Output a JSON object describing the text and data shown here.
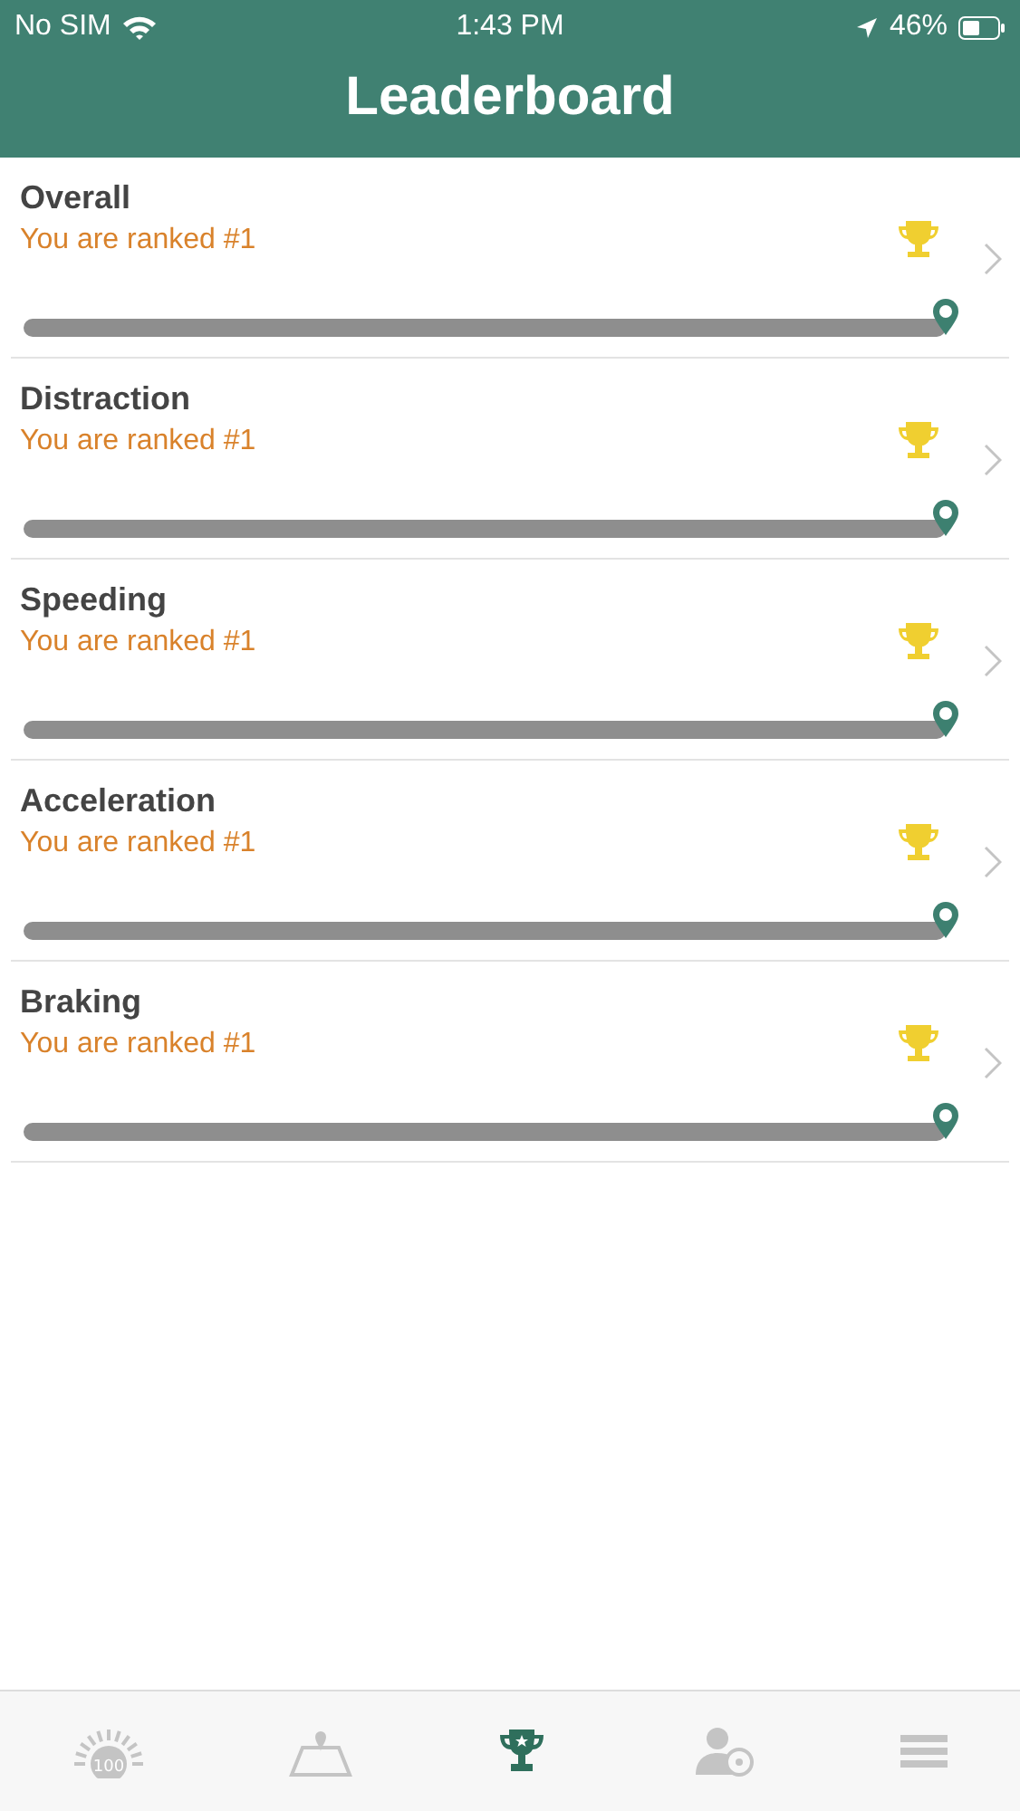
{
  "status_bar": {
    "carrier": "No SIM",
    "time": "1:43 PM",
    "battery": "46%"
  },
  "header": {
    "title": "Leaderboard"
  },
  "rows": [
    {
      "title": "Overall",
      "subtitle": "You are ranked #1",
      "level": 1
    },
    {
      "title": "Distraction",
      "subtitle": "You are ranked #1",
      "level": 1
    },
    {
      "title": "Speeding",
      "subtitle": "You are ranked #1",
      "level": 1
    },
    {
      "title": "Acceleration",
      "subtitle": "You are ranked #1",
      "level": 1
    },
    {
      "title": "Braking",
      "subtitle": "You are ranked #1",
      "level": 1
    }
  ],
  "tab_bar": [
    {
      "kind": "score",
      "badge": "100",
      "selected": false
    },
    {
      "kind": "map",
      "selected": false
    },
    {
      "kind": "trophy",
      "selected": true
    },
    {
      "kind": "driver",
      "selected": false
    },
    {
      "kind": "menu",
      "selected": false
    }
  ]
}
